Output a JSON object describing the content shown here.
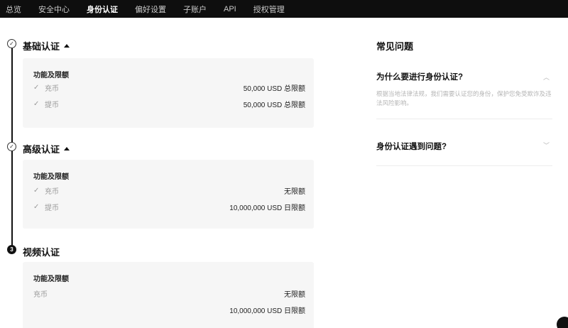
{
  "nav": {
    "tabs": [
      {
        "label": "总览"
      },
      {
        "label": "安全中心"
      },
      {
        "label": "身份认证"
      },
      {
        "label": "偏好设置"
      },
      {
        "label": "子账户"
      },
      {
        "label": "API"
      },
      {
        "label": "授权管理"
      }
    ],
    "active_tab": "身份认证"
  },
  "steps": [
    {
      "title": "基础认证",
      "status": "completed",
      "marker": "✓",
      "card_title": "功能及限额",
      "rows": [
        {
          "name": "充币",
          "limit": "50,000 USD 总限额"
        },
        {
          "name": "提币",
          "limit": "50,000 USD 总限额"
        }
      ]
    },
    {
      "title": "高级认证",
      "status": "completed",
      "marker": "✓",
      "card_title": "功能及限额",
      "rows": [
        {
          "name": "充币",
          "limit": "无限额"
        },
        {
          "name": "提币",
          "limit": "10,000,000 USD 日限额"
        }
      ]
    },
    {
      "title": "视频认证",
      "status": "current",
      "marker": "3",
      "card_title": "功能及限额",
      "rows": [
        {
          "name": "充币",
          "limit": "无限额"
        },
        {
          "name": "",
          "limit": "10,000,000 USD 日限额"
        }
      ]
    }
  ],
  "faq": {
    "title": "常见问题",
    "items": [
      {
        "question": "为什么要进行身份认证?",
        "answer": "根据当地法律法规，我们需要认证您的身份，保护您免受欺诈及违法风险影响。",
        "expanded": true
      },
      {
        "question": "身份认证遇到问题?",
        "expanded": false
      }
    ]
  },
  "colors": {
    "nav_bg": "#0e0e0e",
    "card_bg": "#f6f6f6",
    "muted": "#9a9a9a"
  }
}
